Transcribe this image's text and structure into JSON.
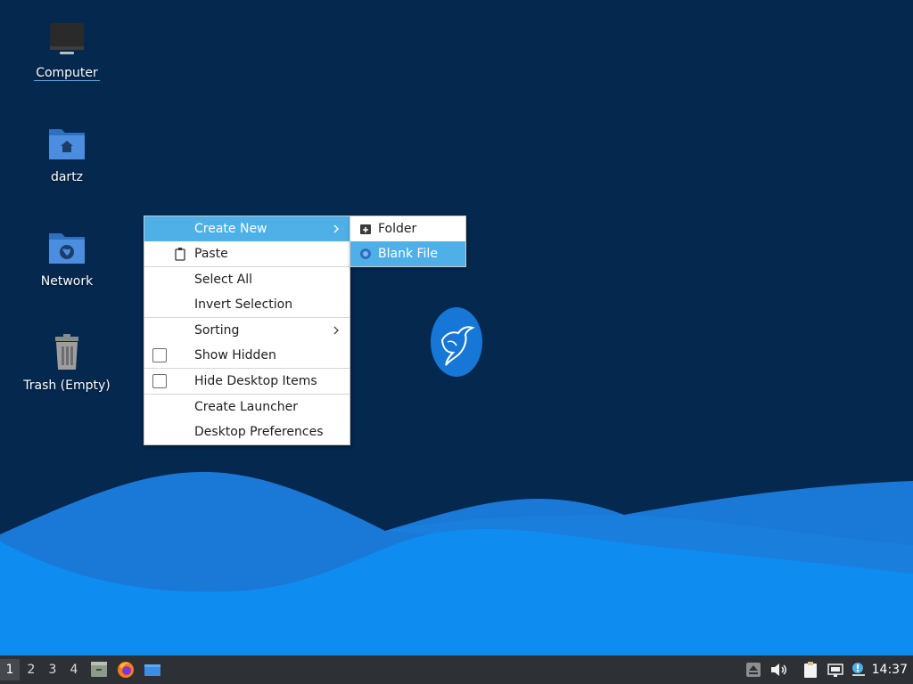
{
  "desktop": {
    "icons": [
      {
        "label": "Computer"
      },
      {
        "label": "dartz"
      },
      {
        "label": "Network"
      },
      {
        "label": "Trash (Empty)"
      }
    ]
  },
  "context_menu": {
    "items": [
      {
        "label": "Create New"
      },
      {
        "label": "Paste"
      },
      {
        "label": "Select All"
      },
      {
        "label": "Invert Selection"
      },
      {
        "label": "Sorting"
      },
      {
        "label": "Show Hidden",
        "checked": false
      },
      {
        "label": "Hide Desktop Items",
        "checked": false
      },
      {
        "label": "Create Launcher"
      },
      {
        "label": "Desktop Preferences"
      }
    ],
    "submenu": {
      "items": [
        {
          "label": "Folder"
        },
        {
          "label": "Blank File"
        }
      ]
    }
  },
  "taskbar": {
    "workspaces": [
      "1",
      "2",
      "3",
      "4"
    ],
    "active_workspace": "1",
    "clock": "14:37"
  },
  "colors": {
    "desktop_bg": "#05284f",
    "menu_highlight": "#4fb0e8",
    "taskbar_bg": "#2d3034"
  }
}
